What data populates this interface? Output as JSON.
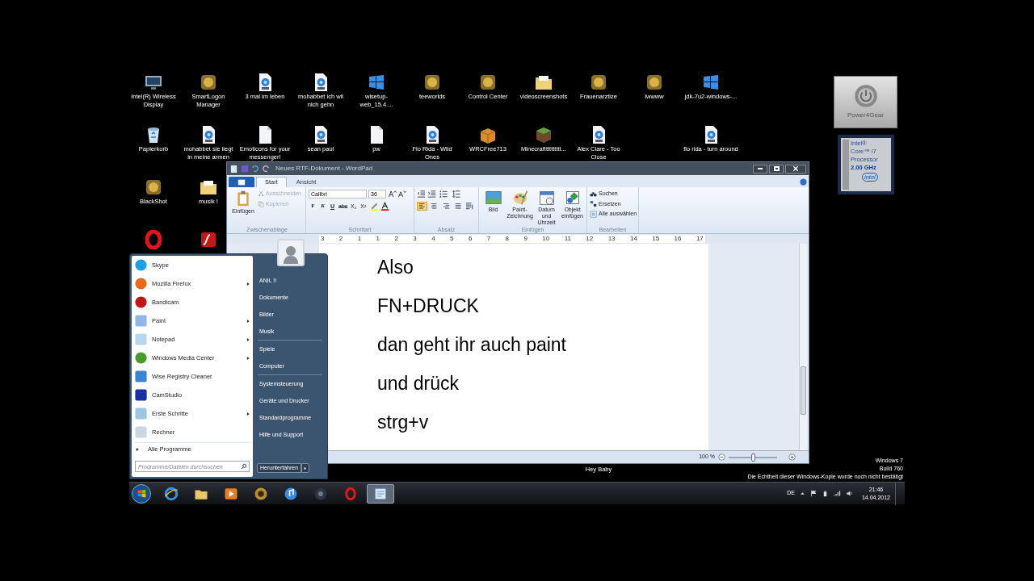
{
  "desktop_icons": [
    {
      "label": "Intel(R) Wireless Display",
      "kind": "monitor"
    },
    {
      "label": "SmartLogon Manager",
      "kind": "app"
    },
    {
      "label": "3 mal im leben",
      "kind": "mp3"
    },
    {
      "label": "mohabbet ich wil nich gehn",
      "kind": "mp3"
    },
    {
      "label": "wlsetup-web_15.4....",
      "kind": "windows"
    },
    {
      "label": "teeworlds",
      "kind": "app"
    },
    {
      "label": "Control Center",
      "kind": "app"
    },
    {
      "label": "videoscreenshots",
      "kind": "folder"
    },
    {
      "label": "Frauenarztize",
      "kind": "app"
    },
    {
      "label": "lwwww",
      "kind": "app"
    },
    {
      "label": "jdk-7u2-windows-...",
      "kind": "windows"
    },
    {
      "label": "Papierkorb",
      "kind": "bin"
    },
    {
      "label": "mohabbet sie liegt in meine armen",
      "kind": "mp3"
    },
    {
      "label": "Emoticons for your messenger!",
      "kind": "file"
    },
    {
      "label": "sean paul",
      "kind": "mp3"
    },
    {
      "label": "pw",
      "kind": "file"
    },
    {
      "label": "Flo Rida - Wild Ones",
      "kind": "mp3"
    },
    {
      "label": "WRCFree713",
      "kind": "box"
    },
    {
      "label": "Minecraftttttttttt...",
      "kind": "block"
    },
    {
      "label": "Alex Clare - Too Close",
      "kind": "mp3"
    },
    {
      "label": "flo rida - turn around",
      "kind": "mp3"
    },
    {
      "label": "BlackShot",
      "kind": "app"
    },
    {
      "label": "musik !",
      "kind": "folder"
    },
    {
      "kind": "opera"
    },
    {
      "kind": "flash"
    },
    {
      "label": "Hey Baby",
      "kind": "covered"
    }
  ],
  "gadgets": {
    "power4gear": "Power4Gear",
    "cpu_lines": [
      "Intel®",
      "Core™ i7",
      "Processor",
      "2.00 GHz"
    ],
    "cpu_logo": "intel"
  },
  "wordpad": {
    "title": "Neues RTF-Dokument - WordPad",
    "tabs": [
      {
        "label": "Start",
        "selected": true
      },
      {
        "label": "Ansicht",
        "selected": false
      }
    ],
    "clipboard": {
      "group": "Zwischenablage",
      "paste": "Einfügen",
      "cut": {
        "label": "Ausschneiden",
        "disabled": true
      },
      "copy": {
        "label": "Kopieren",
        "disabled": true
      }
    },
    "font": {
      "group": "Schriftart",
      "family": "Calibri",
      "size": "36",
      "buttons": [
        "F",
        "K",
        "U",
        "abc",
        "X₂",
        "X²"
      ]
    },
    "paragraph": {
      "group": "Absatz",
      "alignments": [
        {
          "selected": true
        },
        {
          "selected": false
        },
        {
          "selected": false
        },
        {
          "selected": false
        }
      ]
    },
    "insert": {
      "group": "Einfügen",
      "buttons": [
        {
          "label": "Bild",
          "kind": "picture"
        },
        {
          "label": "Paint-Zeichnung",
          "kind": "paint"
        },
        {
          "label": "Datum und Uhrzeit",
          "kind": "calendar"
        },
        {
          "label": "Objekt einfügen",
          "kind": "object"
        }
      ]
    },
    "edit": {
      "group": "Bearbeiten",
      "buttons": [
        "Suchen",
        "Ersetzen",
        "Alle auswählen"
      ]
    },
    "ruler": [
      "3",
      "2",
      "1",
      "1",
      "2",
      "3",
      "4",
      "5",
      "6",
      "7",
      "8",
      "9",
      "10",
      "11",
      "12",
      "13",
      "14",
      "15",
      "16",
      "17"
    ],
    "document_lines": [
      "Also",
      "FN+DRUCK",
      "dan geht ihr auch paint",
      "und drück",
      "strg+v"
    ],
    "zoom": {
      "reading": "100 %",
      "level": 0.5
    }
  },
  "start_menu": {
    "programs": [
      {
        "label": "Skype",
        "kind": "skype",
        "submenu": false
      },
      {
        "label": "Mozilla Firefox",
        "kind": "firefox",
        "submenu": true
      },
      {
        "label": "Bandicam",
        "kind": "bandicam",
        "submenu": false
      },
      {
        "label": "Paint",
        "kind": "paint",
        "submenu": true
      },
      {
        "label": "Notepad",
        "kind": "notepad",
        "submenu": true
      },
      {
        "label": "Windows Media Center",
        "kind": "wmc",
        "submenu": true
      },
      {
        "label": "Wise Registry Cleaner",
        "kind": "wise",
        "submenu": false
      },
      {
        "label": "CamStudio",
        "kind": "camstudio",
        "submenu": false
      },
      {
        "label": "Erste Schritte",
        "kind": "steps",
        "submenu": true
      },
      {
        "label": "Rechner",
        "kind": "calc",
        "submenu": false
      }
    ],
    "all_programs": "Alle Programme",
    "search": {
      "placeholder": "Programme/Dateien durchsuchen"
    },
    "places": [
      {
        "label": "ANIL !!",
        "separator_after": false
      },
      {
        "label": "Dokumente",
        "separator_after": false
      },
      {
        "label": "Bilder",
        "separator_after": false
      },
      {
        "label": "Musik",
        "separator_after": true
      },
      {
        "label": "Spiele",
        "separator_after": false
      },
      {
        "label": "Computer",
        "separator_after": true
      },
      {
        "label": "Systemsteuerung",
        "separator_after": false
      },
      {
        "label": "Geräte und Drucker",
        "separator_after": false
      },
      {
        "label": "Standardprogramme",
        "separator_after": false
      },
      {
        "label": "Hilfe und Support",
        "separator_after": false
      }
    ],
    "shutdown": "Herunterfahren"
  },
  "taskbar": {
    "apps": [
      {
        "kind": "ie",
        "active": false
      },
      {
        "kind": "explorer",
        "active": false
      },
      {
        "kind": "media",
        "active": false
      },
      {
        "kind": "blackshot",
        "active": false
      },
      {
        "kind": "itunes",
        "active": false
      },
      {
        "kind": "dark",
        "active": false
      },
      {
        "kind": "opera",
        "active": false
      },
      {
        "kind": "wordpad",
        "active": true
      }
    ],
    "language": "DE",
    "time": "21:46",
    "date": "14.04.2012"
  },
  "activation_notice": [
    "Windows 7",
    "Build 760",
    "Die Echtheit dieser Windows-Kopie wurde noch nicht bestätigt"
  ]
}
